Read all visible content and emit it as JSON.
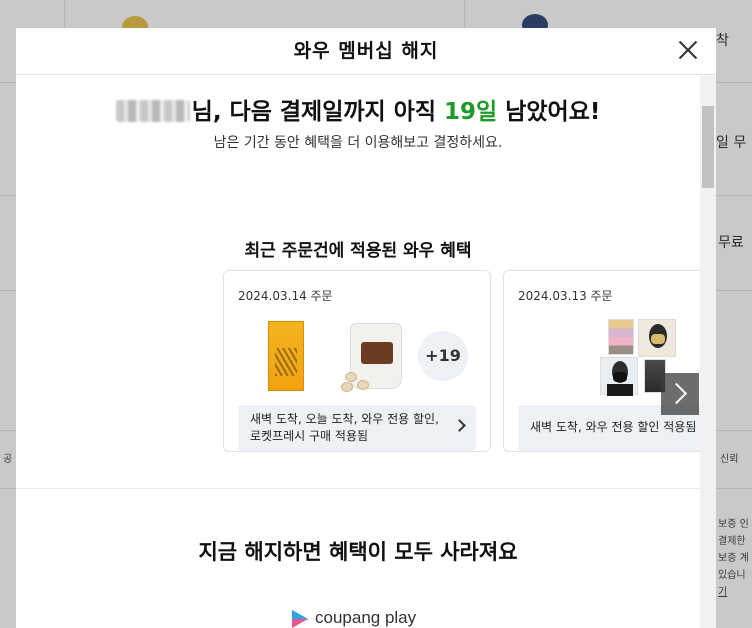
{
  "background": {
    "right_texts": [
      "착",
      "일 무",
      "무료"
    ],
    "left_small": "공",
    "right_small": "신뢰",
    "right_notes": [
      "보증 인",
      "결제한",
      "보증 계",
      "있습니",
      "기"
    ]
  },
  "modal": {
    "title": "와우 멤버십 해지",
    "headline_prefix": "님, 다음 결제일까지 아직 ",
    "headline_days": "19일",
    "headline_suffix": " 남았어요!",
    "subline": "남은 기간 동안 혜택을 더 이용해보고 결정하세요.",
    "recent_title": "최근 주문건에 적용된 와우 혜택",
    "orders": [
      {
        "date": "2024.03.14 주문",
        "more_count": "+19",
        "benefits": "새벽 도착, 오늘 도착, 와우 전용 할인, 로켓프레시 구매 적용됨"
      },
      {
        "date": "2024.03.13 주문",
        "benefits": "새벽 도착, 와우 전용 할인 적용됨"
      }
    ],
    "lose_title": "지금 해지하면 혜택이 모두 사라져요",
    "coupang_play": "coupang play"
  },
  "colors": {
    "accent_green": "#1d9a27",
    "benefit_bg": "#eef1f5"
  }
}
